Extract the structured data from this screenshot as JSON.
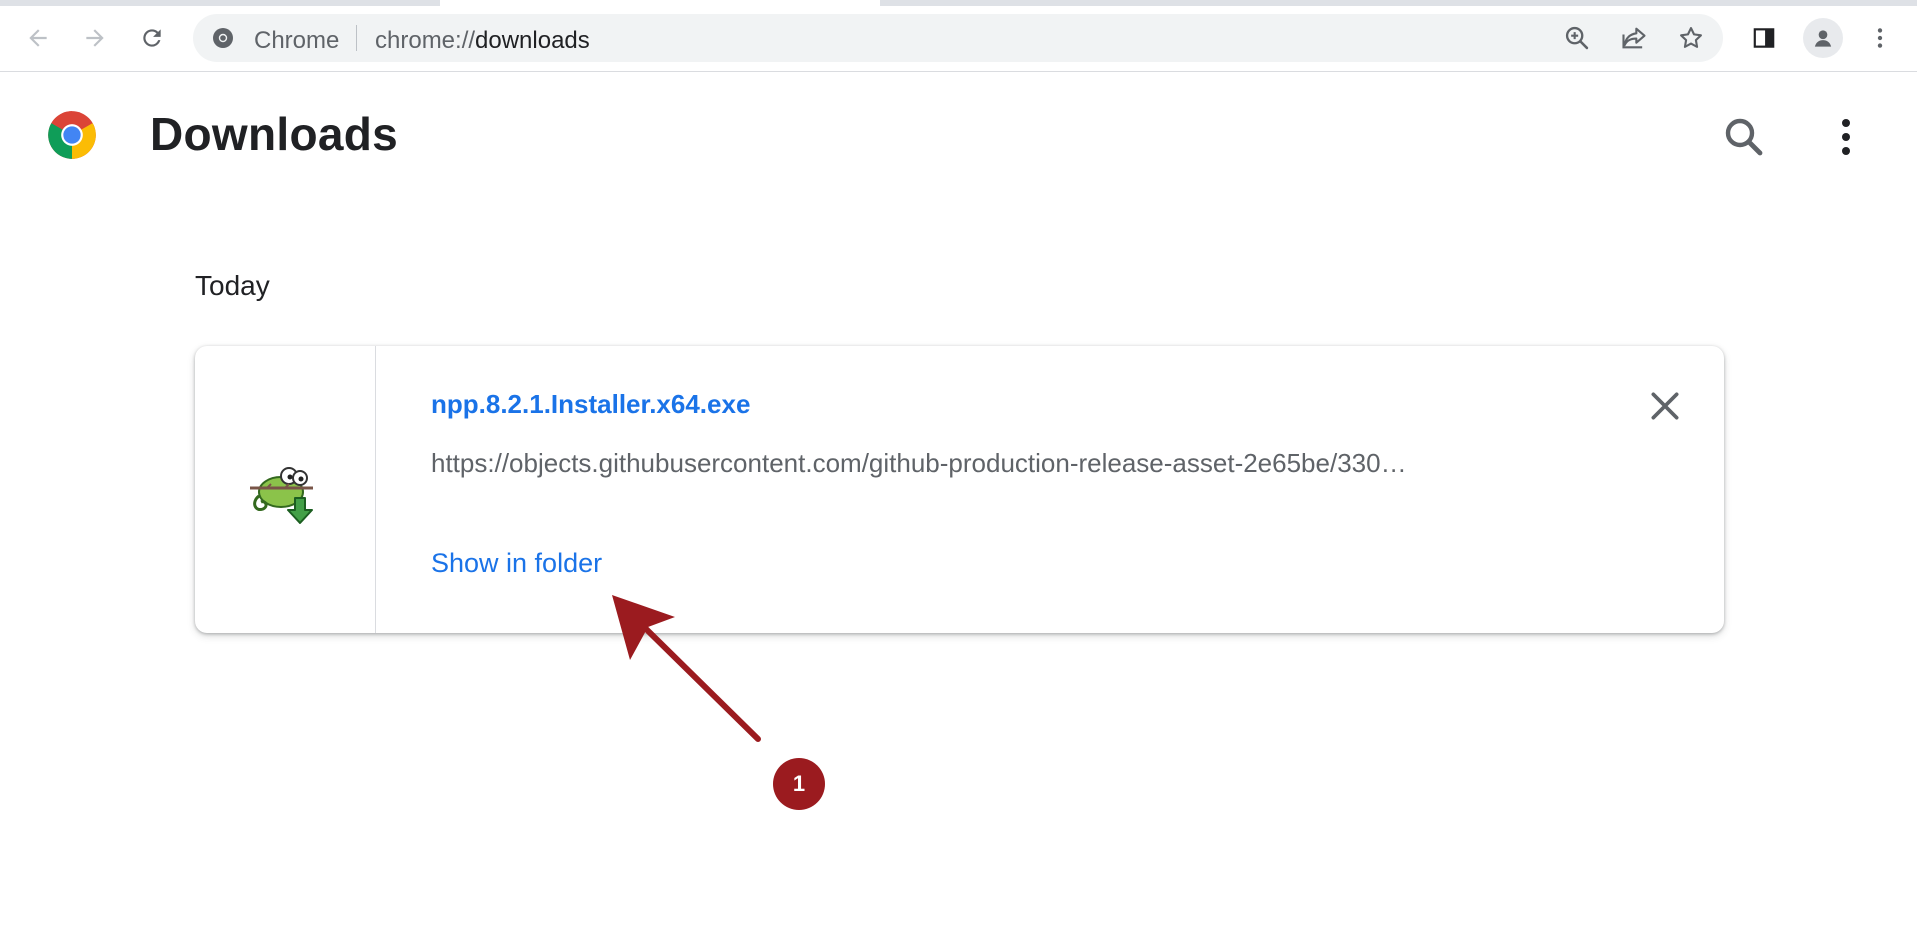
{
  "browser": {
    "site_label": "Chrome",
    "url_scheme": "chrome://",
    "url_path": "downloads"
  },
  "page": {
    "title": "Downloads",
    "section": "Today"
  },
  "download": {
    "file_name": "npp.8.2.1.Installer.x64.exe",
    "source_url": "https://objects.githubusercontent.com/github-production-release-asset-2e65be/330…",
    "action_label": "Show in folder"
  },
  "annotation": {
    "step": "1"
  },
  "colors": {
    "link": "#1a73e8",
    "annotation": "#9b1b1f"
  }
}
